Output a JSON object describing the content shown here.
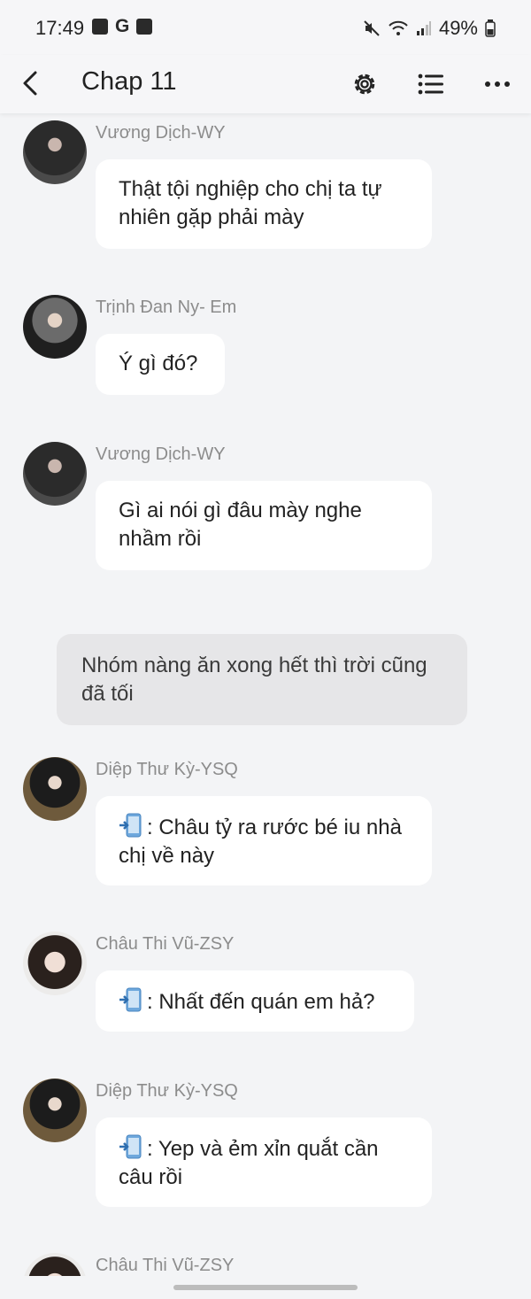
{
  "status_bar": {
    "time": "17:49",
    "battery": "49%"
  },
  "toolbar": {
    "title": "Chap 11"
  },
  "messages": [
    {
      "sender": "Vương Dịch-WY",
      "text": "Thật tội nghiệp cho chị ta tự nhiên gặp phải mày"
    },
    {
      "sender": "Trịnh Đan Ny- Em",
      "text": "Ý gì đó?"
    },
    {
      "sender": "Vương Dịch-WY",
      "text": "Gì ai nói gì đâu mày nghe nhầm rồi"
    },
    {
      "narration": "Nhóm nàng ăn xong hết thì trời cũng đã tối"
    },
    {
      "sender": "Diệp Thư Kỳ-YSQ",
      "text": ": Châu tỷ ra rước bé iu nhà chị về này"
    },
    {
      "sender": "Châu Thi Vũ-ZSY",
      "text": ": Nhất đến quán em hả?"
    },
    {
      "sender": "Diệp Thư Kỳ-YSQ",
      "text": ": Yep và ẻm xỉn quắt cần câu rồi"
    },
    {
      "sender": "Châu Thi Vũ-ZSY"
    }
  ],
  "colors": {
    "background": "#f3f4f6",
    "bubble": "#ffffff",
    "narration": "#e6e6e8",
    "sender": "#8c8c8c"
  },
  "icons": [
    "back-arrow-icon",
    "gear-icon",
    "list-icon",
    "more-icon",
    "phone-icon"
  ]
}
